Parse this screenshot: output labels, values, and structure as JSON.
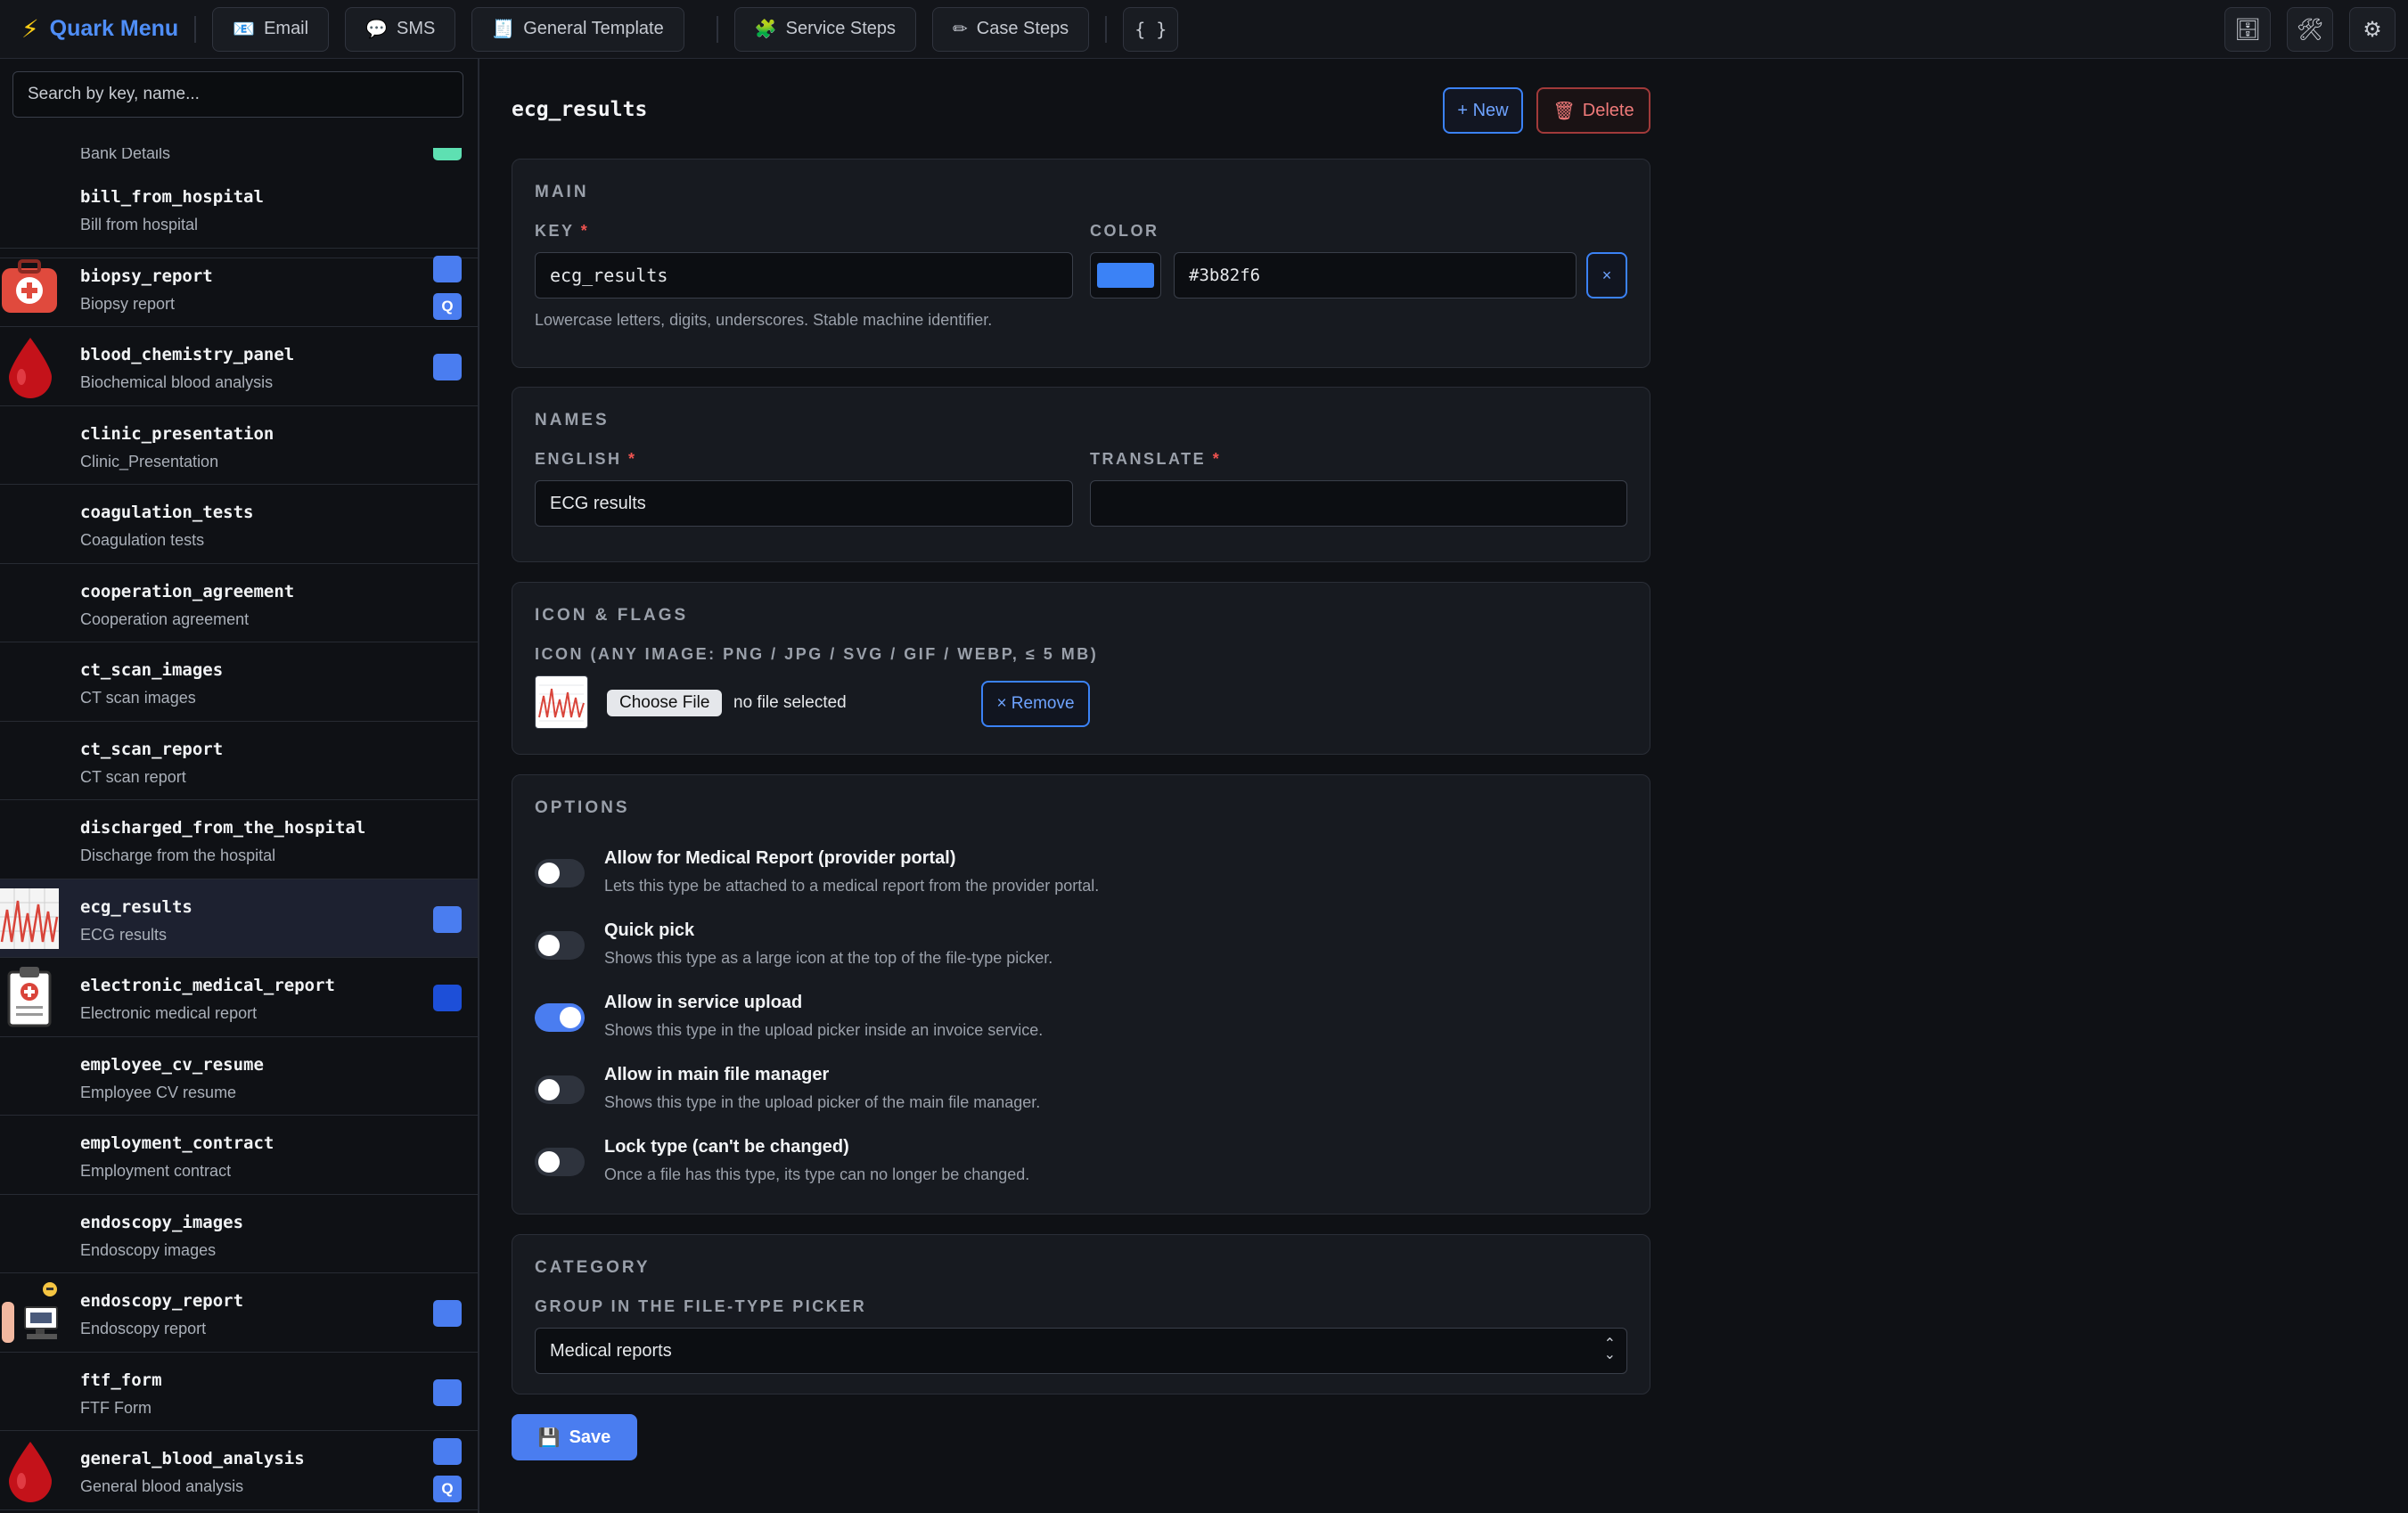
{
  "app": {
    "title": "Quark Menu"
  },
  "toolbar": {
    "buttons": [
      {
        "label": "Email",
        "icon": "envelope-icon"
      },
      {
        "label": "SMS",
        "icon": "speech-bubble-icon"
      },
      {
        "label": "General Template",
        "icon": "document-icon"
      },
      {
        "label": "Service Steps",
        "icon": "puzzle-icon"
      },
      {
        "label": "Case Steps",
        "icon": "pencil-icon"
      },
      {
        "label": "{ }",
        "icon": "braces-icon"
      }
    ],
    "right_icons": [
      "file-cabinet-icon",
      "tools-icon",
      "gear-icon"
    ]
  },
  "sidebar": {
    "search_placeholder": "Search by key, name...",
    "partial_item_name": "Bank Details",
    "items": [
      {
        "key": "bill_from_hospital",
        "name": "Bill from hospital",
        "icon": "",
        "badge": "",
        "q": false
      },
      {
        "key": "biopsy_report",
        "name": "Biopsy report",
        "icon": "medical-bag-icon",
        "badge": "#4a7df0",
        "q": true
      },
      {
        "key": "blood_chemistry_panel",
        "name": "Biochemical blood analysis",
        "icon": "blood-drop-icon",
        "badge": "#4a7df0",
        "q": false
      },
      {
        "key": "clinic_presentation",
        "name": "Clinic_Presentation",
        "icon": "",
        "badge": "",
        "q": false
      },
      {
        "key": "coagulation_tests",
        "name": "Coagulation tests",
        "icon": "",
        "badge": "",
        "q": false
      },
      {
        "key": "cooperation_agreement",
        "name": "Cooperation agreement",
        "icon": "",
        "badge": "",
        "q": false
      },
      {
        "key": "ct_scan_images",
        "name": "CT scan images",
        "icon": "",
        "badge": "",
        "q": false
      },
      {
        "key": "ct_scan_report",
        "name": "CT scan report",
        "icon": "",
        "badge": "",
        "q": false
      },
      {
        "key": "discharged_from_the_hospital",
        "name": "Discharge from the hospital",
        "icon": "",
        "badge": "",
        "q": false
      },
      {
        "key": "ecg_results",
        "name": "ECG results",
        "icon": "ecg-chart-icon",
        "badge": "#4a7df0",
        "q": false
      },
      {
        "key": "electronic_medical_report",
        "name": "Electronic medical report",
        "icon": "clipboard-icon",
        "badge": "#1d4fd8",
        "q": false
      },
      {
        "key": "employee_cv_resume",
        "name": "Employee CV resume",
        "icon": "",
        "badge": "",
        "q": false
      },
      {
        "key": "employment_contract",
        "name": "Employment contract",
        "icon": "",
        "badge": "",
        "q": false
      },
      {
        "key": "endoscopy_images",
        "name": "Endoscopy images",
        "icon": "",
        "badge": "",
        "q": false
      },
      {
        "key": "endoscopy_report",
        "name": "Endoscopy report",
        "icon": "doctor-monitor-icon",
        "badge": "#4a7df0",
        "q": false
      },
      {
        "key": "ftf_form",
        "name": "FTF Form",
        "icon": "",
        "badge": "#4a7df0",
        "q": false
      },
      {
        "key": "general_blood_analysis",
        "name": "General blood analysis",
        "icon": "blood-drop-icon",
        "badge": "#4a7df0",
        "q": true
      }
    ],
    "q_label": "Q"
  },
  "main": {
    "title": "ecg_results",
    "new_label": "+ New",
    "delete_label": "Delete",
    "sections": {
      "main": {
        "title": "MAIN",
        "key_label": "KEY",
        "key_value": "ecg_results",
        "key_hint": "Lowercase letters, digits, underscores. Stable machine identifier.",
        "color_label": "COLOR",
        "color_value": "#3b82f6",
        "clear_label": "×"
      },
      "names": {
        "title": "NAMES",
        "english_label": "ENGLISH",
        "english_value": "ECG results",
        "translate_label": "TRANSLATE",
        "translate_value": ""
      },
      "icon": {
        "title": "ICON & FLAGS",
        "icon_label": "ICON (ANY IMAGE: PNG / JPG / SVG / GIF / WEBP, ≤ 5 MB)",
        "choose_label": "Choose File",
        "nofile_label": "no file selected",
        "remove_label": "× Remove"
      },
      "options": {
        "title": "OPTIONS",
        "items": [
          {
            "title": "Allow for Medical Report (provider portal)",
            "desc": "Lets this type be attached to a medical report from the provider portal.",
            "on": false
          },
          {
            "title": "Quick pick",
            "desc": "Shows this type as a large icon at the top of the file-type picker.",
            "on": false
          },
          {
            "title": "Allow in service upload",
            "desc": "Shows this type in the upload picker inside an invoice service.",
            "on": true
          },
          {
            "title": "Allow in main file manager",
            "desc": "Shows this type in the upload picker of the main file manager.",
            "on": false
          },
          {
            "title": "Lock type (can't be changed)",
            "desc": "Once a file has this type, its type can no longer be changed.",
            "on": false
          }
        ]
      },
      "category": {
        "title": "CATEGORY",
        "group_label": "GROUP IN THE FILE-TYPE PICKER",
        "group_value": "Medical reports"
      }
    },
    "save_label": "Save"
  }
}
